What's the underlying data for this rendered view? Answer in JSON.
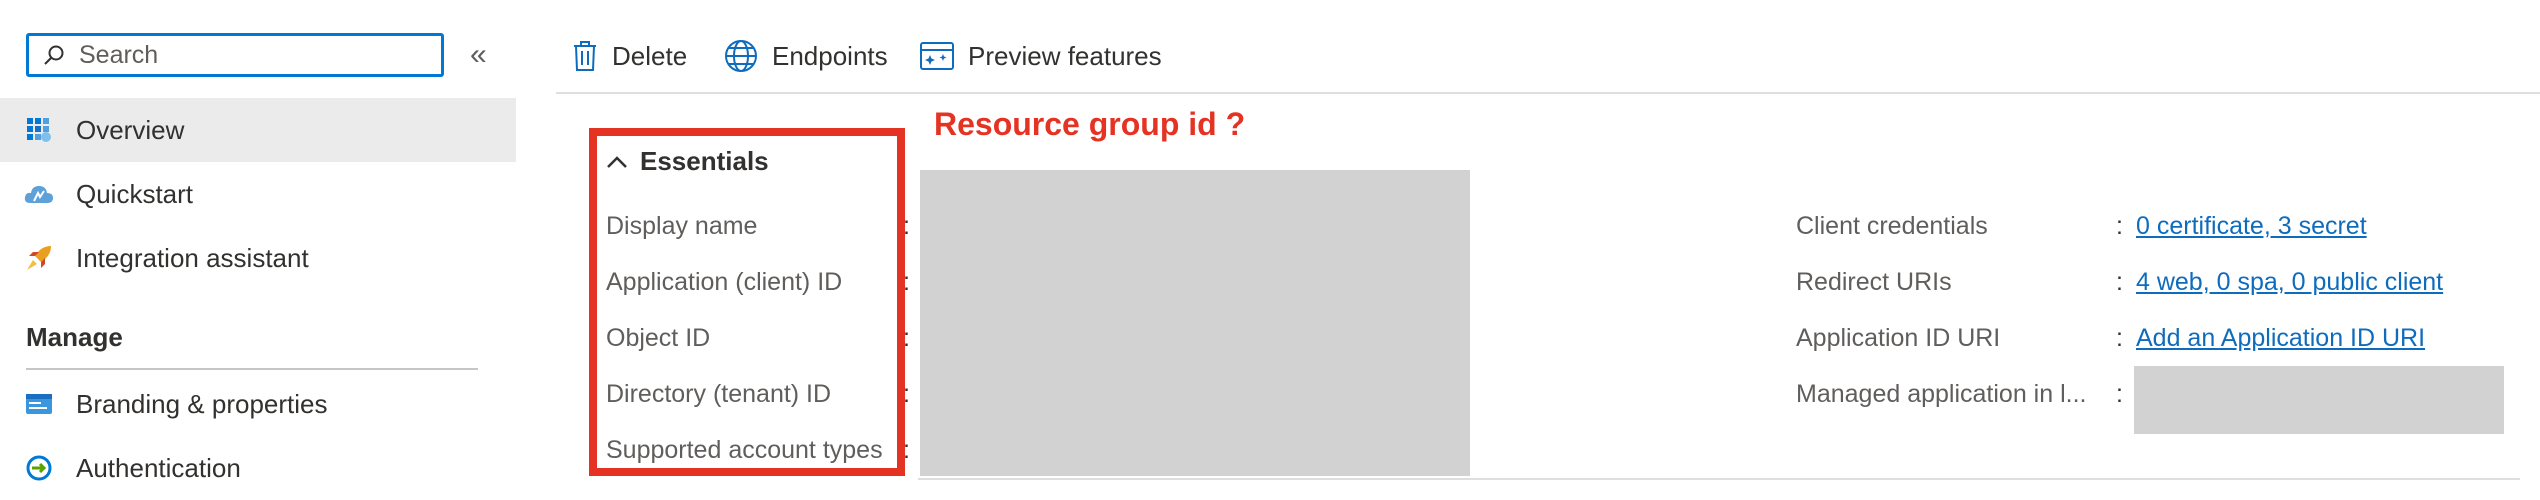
{
  "sidebar": {
    "search": {
      "placeholder": "Search",
      "value": ""
    },
    "collapse_icon": "«",
    "items": [
      {
        "label": "Overview",
        "icon": "overview-grid-icon"
      },
      {
        "label": "Quickstart",
        "icon": "cloud-icon"
      },
      {
        "label": "Integration assistant",
        "icon": "rocket-icon"
      }
    ],
    "section": "Manage",
    "manage_items": [
      {
        "label": "Branding & properties",
        "icon": "branding-icon"
      },
      {
        "label": "Authentication",
        "icon": "authentication-icon"
      }
    ]
  },
  "toolbar": {
    "delete_label": "Delete",
    "endpoints_label": "Endpoints",
    "preview_label": "Preview features"
  },
  "annotation": {
    "text": "Resource group id ?",
    "color": "#e53323"
  },
  "essentials": {
    "title": "Essentials",
    "left_fields": [
      {
        "label": "Display name"
      },
      {
        "label": "Application (client) ID"
      },
      {
        "label": "Object ID"
      },
      {
        "label": "Directory (tenant) ID"
      },
      {
        "label": "Supported account types"
      }
    ],
    "right_fields": [
      {
        "label": "Client credentials",
        "value": "0 certificate, 3 secret"
      },
      {
        "label": "Redirect URIs",
        "value": "4 web, 0 spa, 0 public client"
      },
      {
        "label": "Application ID URI",
        "value": "Add an Application ID URI"
      },
      {
        "label": "Managed application in l...",
        "value": ""
      }
    ],
    "colon": ":"
  },
  "colors": {
    "accent": "#0078d4",
    "link": "#0f6cbd",
    "selected_bg": "#ebebeb",
    "redaction": "#d2d2d2"
  }
}
